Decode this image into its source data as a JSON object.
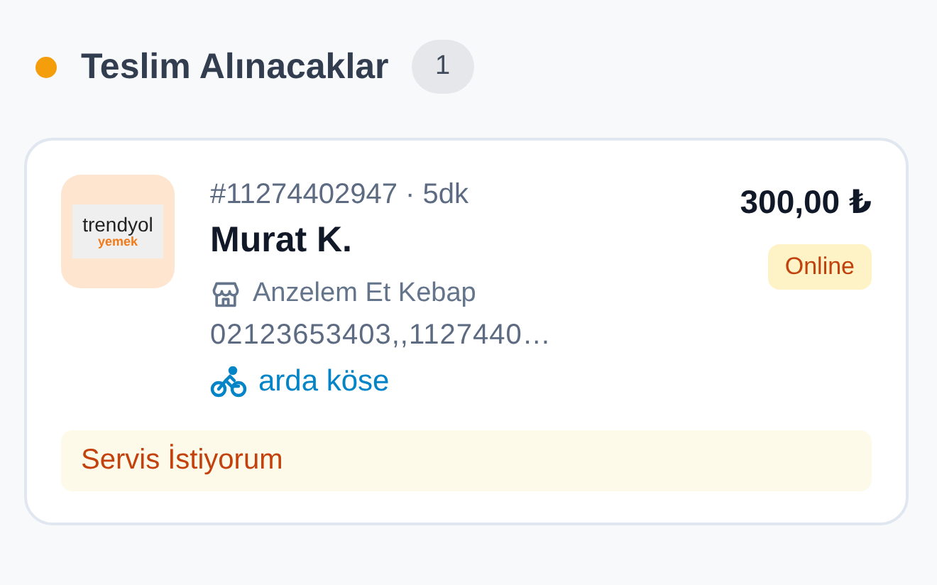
{
  "section": {
    "title": "Teslim Alınacaklar",
    "count": "1",
    "color": "#f59e0b"
  },
  "orders": [
    {
      "logo": {
        "name": "trendyol",
        "sub": "yemek"
      },
      "order_no": "#11274402947 · 5dk",
      "customer": "Murat K.",
      "store": "Anzelem Et Kebap",
      "phone": "02123653403,,1127440…",
      "courier": "arda köse",
      "total": "300,00 ₺",
      "payment": "Online",
      "note": "Servis İstiyorum"
    }
  ]
}
